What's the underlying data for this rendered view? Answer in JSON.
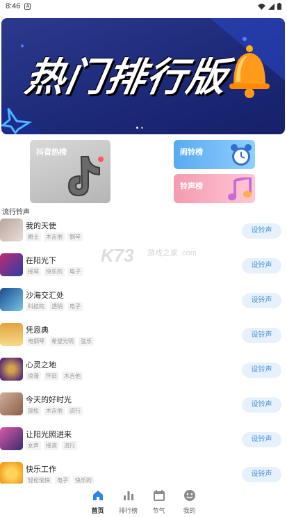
{
  "status_bar": {
    "time": "8:46",
    "notif_letter": "A"
  },
  "banner": {
    "title": "热门排行版",
    "slides": 2,
    "active_slide": 0
  },
  "cards": {
    "douyin": "抖音热榜",
    "alarm": "闹铃榜",
    "ring": "铃声榜"
  },
  "section_title": "流行铃声",
  "watermark": {
    "main": "K73",
    "sub": "游戏之家 .com"
  },
  "songs": [
    {
      "name": "我的天使",
      "tags": [
        "爵士",
        "木吉他",
        "钢琴"
      ],
      "button": "设铃声",
      "color_a": "#b9a6a0",
      "color_b": "#e8ddd6"
    },
    {
      "name": "在阳光下",
      "tags": [
        "摇琴",
        "快乐的",
        "电子"
      ],
      "button": "设铃声",
      "color_a": "#c02b6f",
      "color_b": "#2a3da8"
    },
    {
      "name": "沙海交汇处",
      "tags": [
        "科技的",
        "透明",
        "电子"
      ],
      "button": "设铃声",
      "color_a": "#1a4c8c",
      "color_b": "#76c5e8"
    },
    {
      "name": "凭恩典",
      "tags": [
        "电钢琴",
        "希望光明",
        "弦乐"
      ],
      "button": "设铃声",
      "color_a": "#e0a33c",
      "color_b": "#f7d98a"
    },
    {
      "name": "心灵之地",
      "tags": [
        "浪漫",
        "怀旧",
        "木吉他"
      ],
      "button": "设铃声",
      "color_a": "#d4a24a",
      "color_b": "#5b2f75"
    },
    {
      "name": "今天的好时光",
      "tags": [
        "放松",
        "木吉他",
        "流行"
      ],
      "button": "设铃声",
      "color_a": "#cfae98",
      "color_b": "#8a5e4b"
    },
    {
      "name": "让阳光照进来",
      "tags": [
        "女声",
        "摇滚",
        "流行"
      ],
      "button": "设铃声",
      "color_a": "#d65aa8",
      "color_b": "#3c2a6e"
    },
    {
      "name": "快乐工作",
      "tags": [
        "轻松愉快",
        "电子",
        "快乐的"
      ],
      "button": "设铃声",
      "color_a": "#f0a020",
      "color_b": "#ffd35a"
    }
  ],
  "tabs": [
    {
      "label": "首页",
      "icon": "home-icon",
      "active": true
    },
    {
      "label": "排行榜",
      "icon": "bar-chart-icon",
      "active": false
    },
    {
      "label": "节气",
      "icon": "calendar-icon",
      "active": false
    },
    {
      "label": "我的",
      "icon": "smiley-icon",
      "active": false
    }
  ],
  "colors": {
    "accent": "#4a93d8",
    "button_bg": "#e6f1fb",
    "tab_active": "#2f86e0"
  }
}
